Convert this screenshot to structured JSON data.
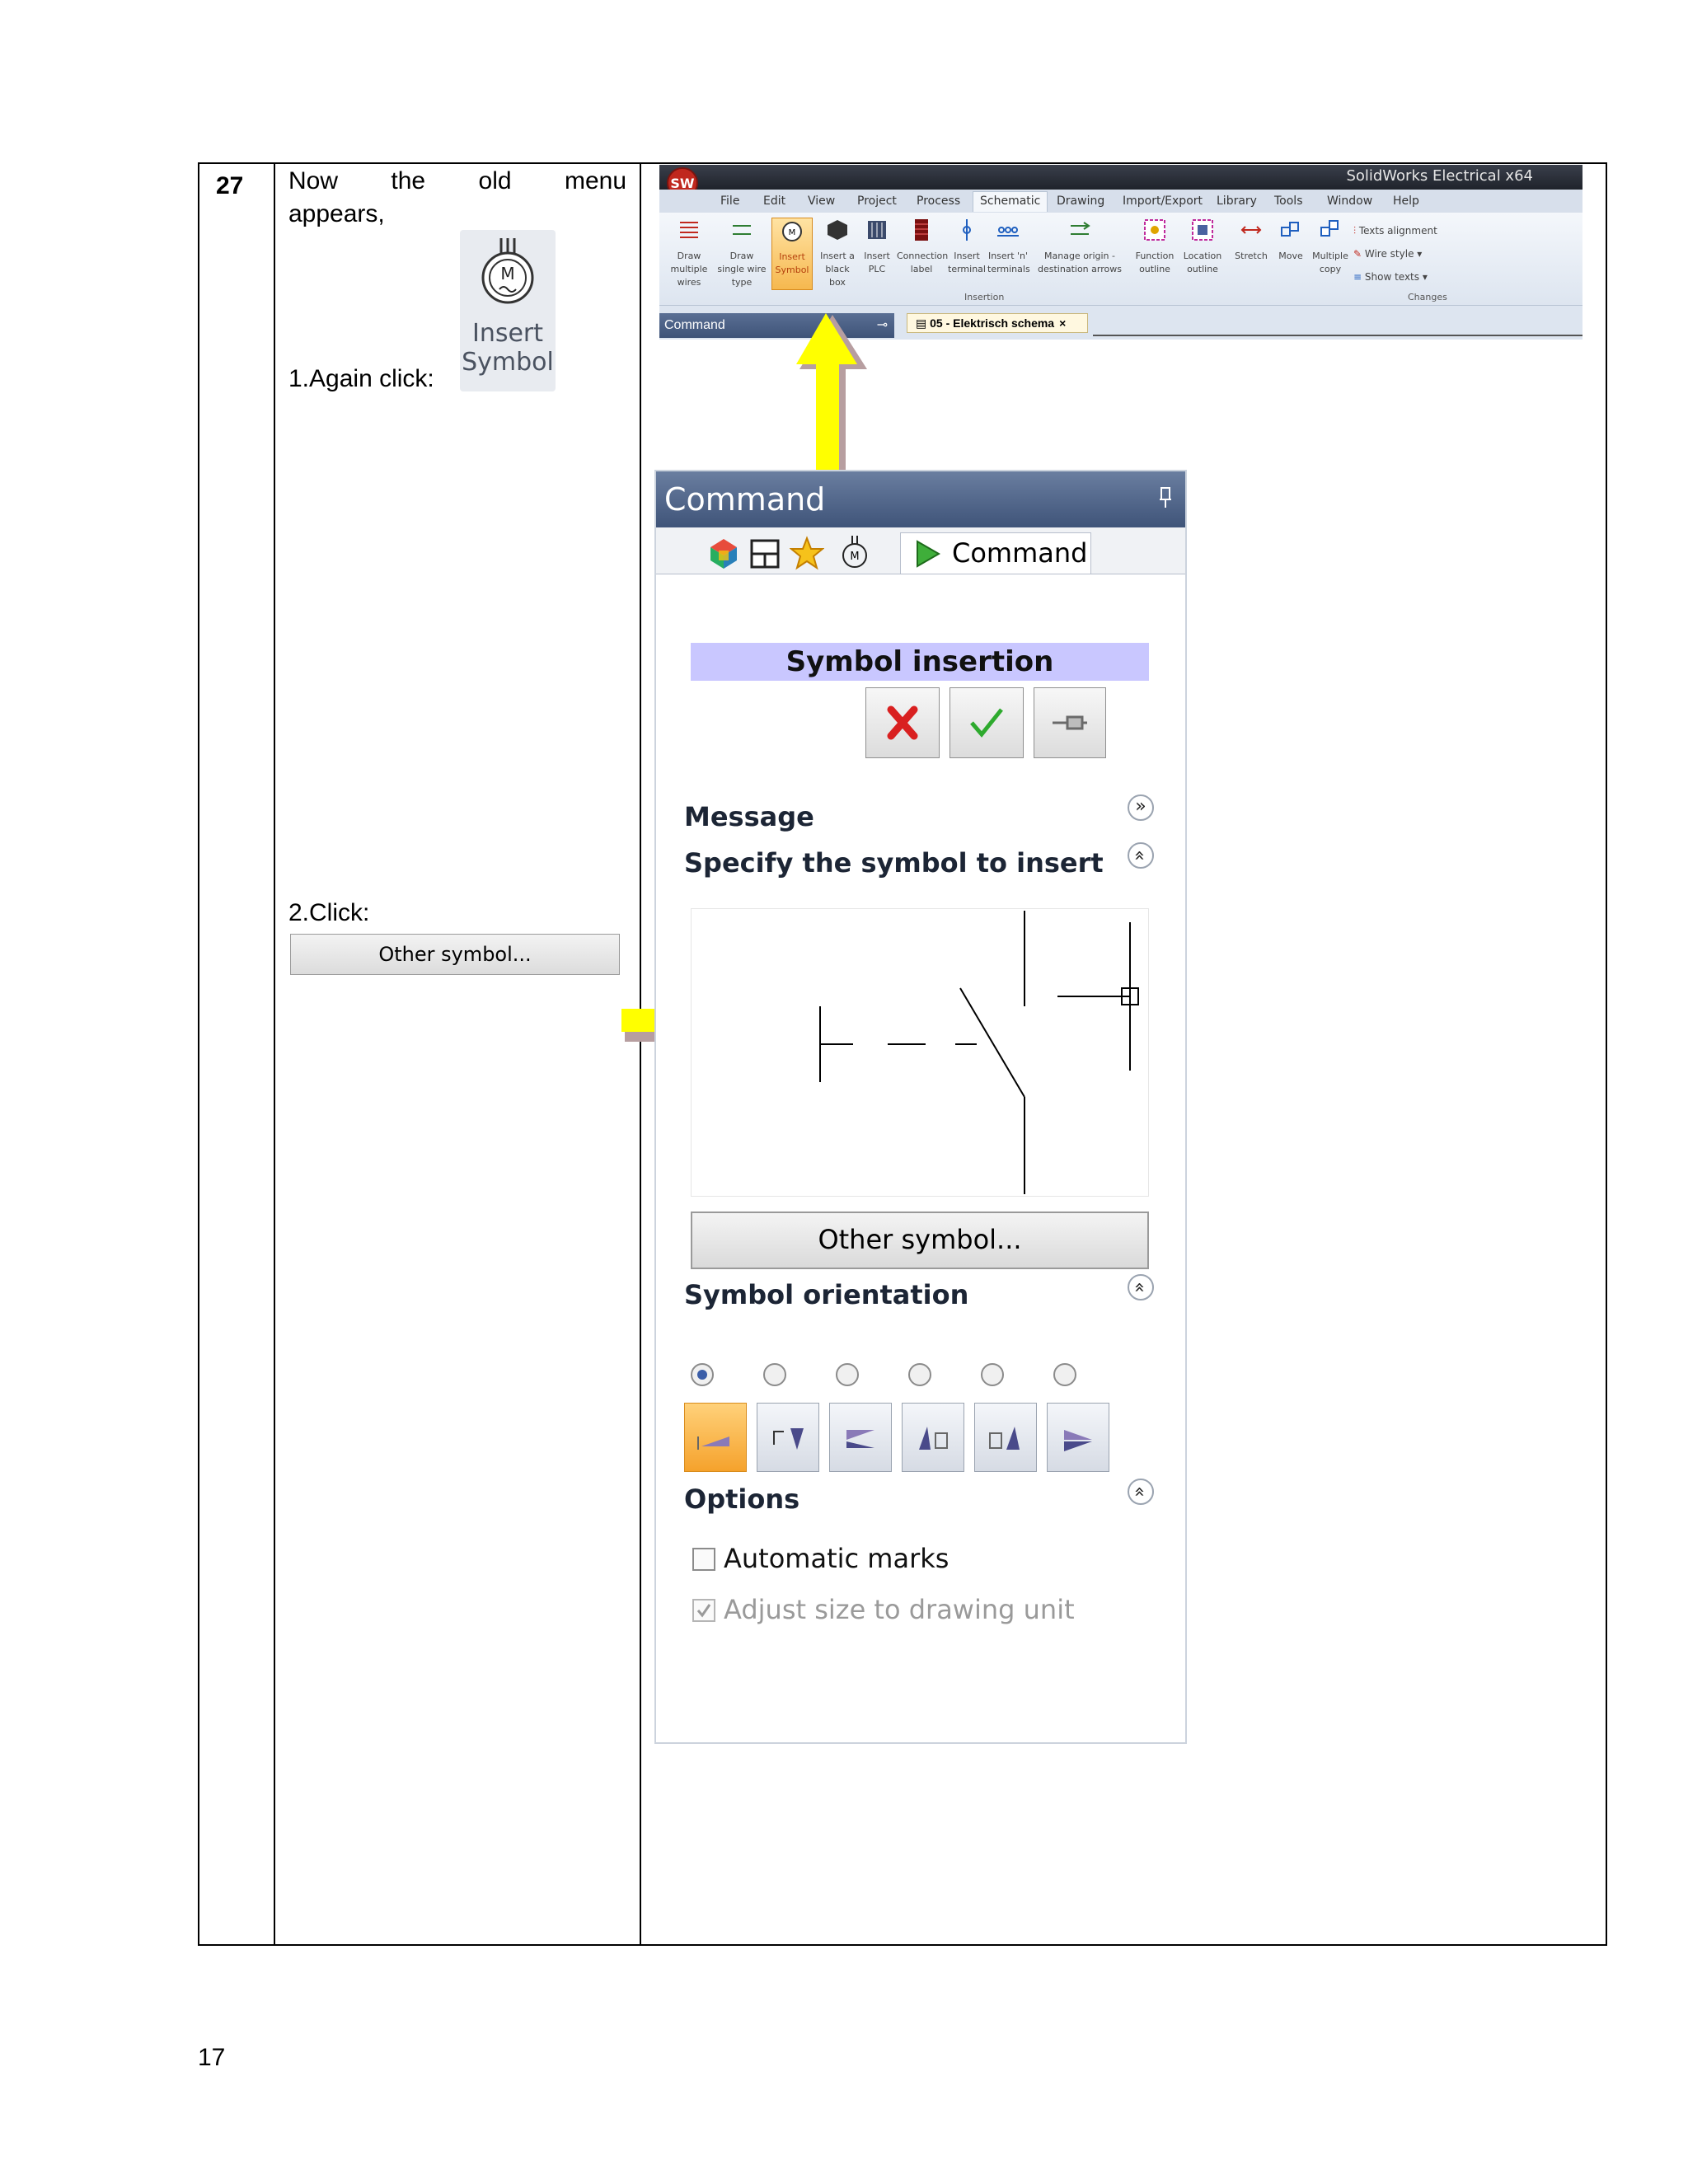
{
  "step": {
    "number": "27",
    "intro_words": [
      "Now",
      "the",
      "old",
      "menu"
    ],
    "intro_line2": "appears,",
    "instruction1": "1.Again click:",
    "instruction2": "2.Click:",
    "inline_icon_label_1": "Insert",
    "inline_icon_label_2": "Symbol",
    "other_symbol_small": "Other symbol..."
  },
  "ribbon": {
    "window_title": "SolidWorks Electrical x64",
    "menu": [
      "File",
      "Edit",
      "View",
      "Project",
      "Process",
      "Schematic",
      "Drawing",
      "Import/Export",
      "Library",
      "Tools",
      "Window",
      "Help"
    ],
    "active_menu": "Schematic",
    "items": [
      {
        "label": "Draw multiple wires",
        "icon": "wires-icon"
      },
      {
        "label": "Draw single wire type",
        "icon": "wire-icon"
      },
      {
        "label": "Insert Symbol",
        "icon": "motor-symbol-icon"
      },
      {
        "label": "Insert a black box",
        "icon": "black-box-icon"
      },
      {
        "label": "Insert PLC",
        "icon": "plc-icon"
      },
      {
        "label": "Connection label",
        "icon": "connection-label-icon"
      },
      {
        "label": "Insert terminal",
        "icon": "terminal-icon"
      },
      {
        "label": "Insert 'n' terminals",
        "icon": "terminals-icon"
      },
      {
        "label": "Manage origin - destination arrows",
        "icon": "arrows-icon"
      },
      {
        "label": "Function outline",
        "icon": "function-outline-icon"
      },
      {
        "label": "Location outline",
        "icon": "location-outline-icon"
      },
      {
        "label": "Stretch",
        "icon": "stretch-icon"
      },
      {
        "label": "Move",
        "icon": "move-icon"
      },
      {
        "label": "Multiple copy",
        "icon": "copy-icon"
      }
    ],
    "side_items": [
      "Texts alignment",
      "Wire style",
      "Show texts"
    ],
    "section_insertion": "Insertion",
    "section_changes": "Changes",
    "command_bar": "Command",
    "doc_tab": "05 - Elektrisch schema"
  },
  "panel": {
    "title": "Command",
    "tab_label": "Command",
    "symbol_insertion": "Symbol insertion",
    "message_title": "Message",
    "message_text": "Specify the symbol to insert",
    "other_symbol": "Other symbol...",
    "orientation_title": "Symbol orientation",
    "options_title": "Options",
    "option1": "Automatic marks",
    "option2": "Adjust size to drawing unit",
    "option1_checked": false,
    "option2_checked": true,
    "selected_orientation": 0
  },
  "colors": {
    "arrow": "#ffff00",
    "header": "#4a5f86",
    "symbol_insertion_bg": "#c9c7ff",
    "active_orientation": "#f5a22c"
  },
  "page_number": "17"
}
